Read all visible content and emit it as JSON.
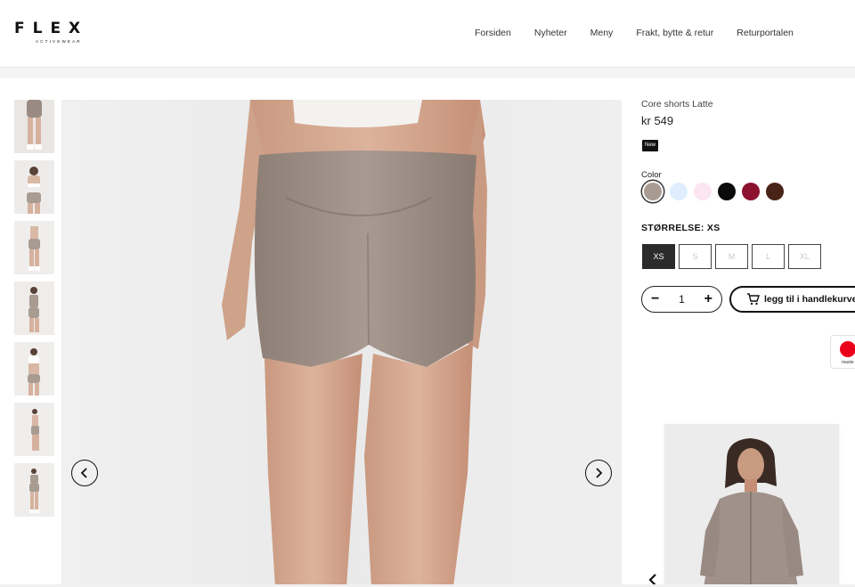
{
  "brand": {
    "name": "FLEX",
    "tagline": "ACTIVEWEAR"
  },
  "nav": {
    "items": [
      {
        "label": "Forsiden"
      },
      {
        "label": "Nyheter"
      },
      {
        "label": "Meny"
      },
      {
        "label": "Frakt, bytte & retur"
      },
      {
        "label": "Returportalen"
      }
    ]
  },
  "gallery": {
    "thumbnail_count": 7,
    "main_image": "back-view-shorts-photo",
    "icons": {
      "prev": "chevron-left-icon",
      "next": "chevron-right-icon"
    }
  },
  "product": {
    "title": "Core shorts Latte",
    "price": "kr 549",
    "badge": "New",
    "color_label": "Color",
    "colors": [
      {
        "name": "latte",
        "hex": "#a89b92",
        "selected": true
      },
      {
        "name": "light-blue",
        "hex": "#dfeeff",
        "selected": false
      },
      {
        "name": "light-pink",
        "hex": "#fbe6f1",
        "selected": false
      },
      {
        "name": "black",
        "hex": "#0a0a0a",
        "selected": false
      },
      {
        "name": "burgundy",
        "hex": "#8c1230",
        "selected": false
      },
      {
        "name": "brown",
        "hex": "#4a2318",
        "selected": false
      }
    ],
    "size_label": "STØRRELSE: XS",
    "sizes": [
      {
        "label": "XS",
        "selected": true
      },
      {
        "label": "S",
        "selected": false
      },
      {
        "label": "M",
        "selected": false
      },
      {
        "label": "L",
        "selected": false
      },
      {
        "label": "XL",
        "selected": false
      }
    ],
    "quantity": "1",
    "qty_minus": "−",
    "qty_plus": "+",
    "add_to_cart": "legg til i handlekurven",
    "payment_text": "maste"
  },
  "recommendation": {
    "image": "woman-in-latte-zip-jacket-photo"
  },
  "theme": {
    "accent": "#111111",
    "selected_size_bg": "#2b2b2b"
  }
}
